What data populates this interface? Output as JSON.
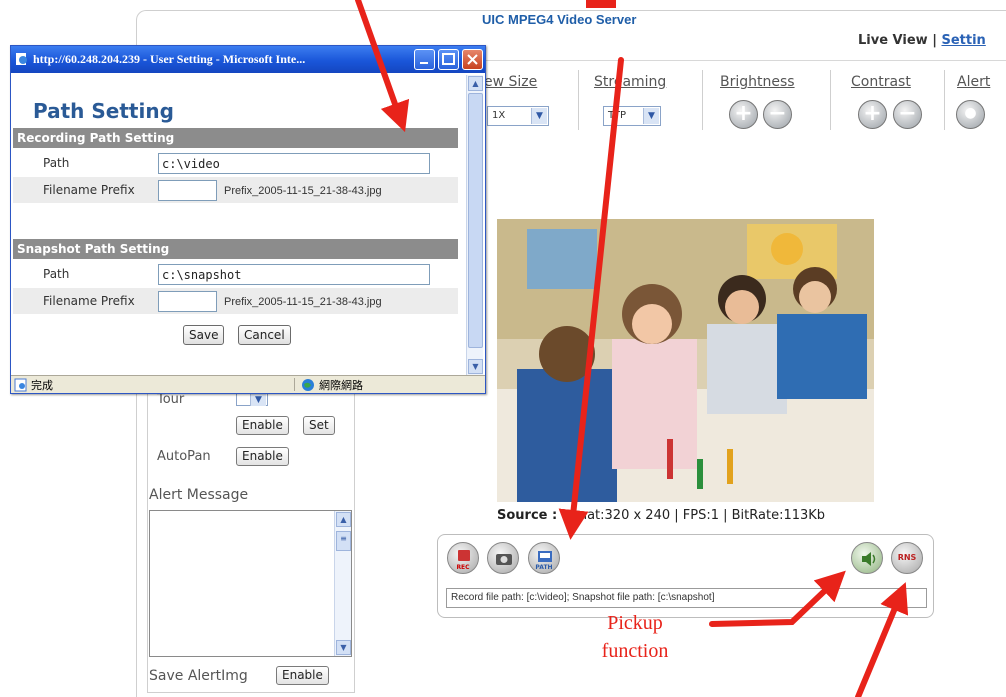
{
  "server": {
    "title": "UIC MPEG4 Video Server"
  },
  "top_nav": {
    "live_view": "Live View",
    "separator": "|",
    "setting": "Settin"
  },
  "controls": {
    "view_size": {
      "label": "ew Size",
      "value": "1X"
    },
    "streaming": {
      "label": "Streaming",
      "value": "TTP"
    },
    "brightness": {
      "label": "Brightness"
    },
    "contrast": {
      "label": "Contrast"
    },
    "alert": {
      "label": "Alert"
    }
  },
  "video": {
    "source_label": "Source :",
    "source_info": "ormat:320 x 240 | FPS:1 | BitRate:113Kb"
  },
  "toolbar": {
    "rec_tag": "REC",
    "path_tag": "PATH",
    "rns_tag": "RNS",
    "path_status": "Record file path: [c:\\video]; Snapshot file path: [c:\\snapshot]"
  },
  "left_panel": {
    "tour_label": "Tour",
    "enable_label": "Enable",
    "set_label": "Set",
    "autopan_label": "AutoPan",
    "autopan_enable": "Enable",
    "alert_message_label": "Alert Message",
    "save_alertimg_label": "Save AlertImg",
    "save_alertimg_enable": "Enable"
  },
  "popup": {
    "window_title": "http://60.248.204.239 - User Setting - Microsoft Inte...",
    "heading": "Path Setting",
    "recording": {
      "section_title": "Recording Path Setting",
      "path_label": "Path",
      "path_value": "c:\\video",
      "prefix_label": "Filename Prefix",
      "prefix_value": "",
      "prefix_example": "Prefix_2005-11-15_21-38-43.jpg"
    },
    "snapshot": {
      "section_title": "Snapshot Path Setting",
      "path_label": "Path",
      "path_value": "c:\\snapshot",
      "prefix_label": "Filename Prefix",
      "prefix_value": "",
      "prefix_example": "Prefix_2005-11-15_21-38-43.jpg"
    },
    "save_label": "Save",
    "cancel_label": "Cancel",
    "status_done": "完成",
    "status_zone": "網際網路"
  },
  "annotations": {
    "pickup_line1": "Pickup",
    "pickup_line2": "function",
    "arrow_color": "#e8231a"
  },
  "colors": {
    "heading_blue": "#2a5a96",
    "section_gray": "#8c8c8c",
    "server_title_blue": "#1f5ea8",
    "xp_titlebar": "#1a56d9"
  }
}
